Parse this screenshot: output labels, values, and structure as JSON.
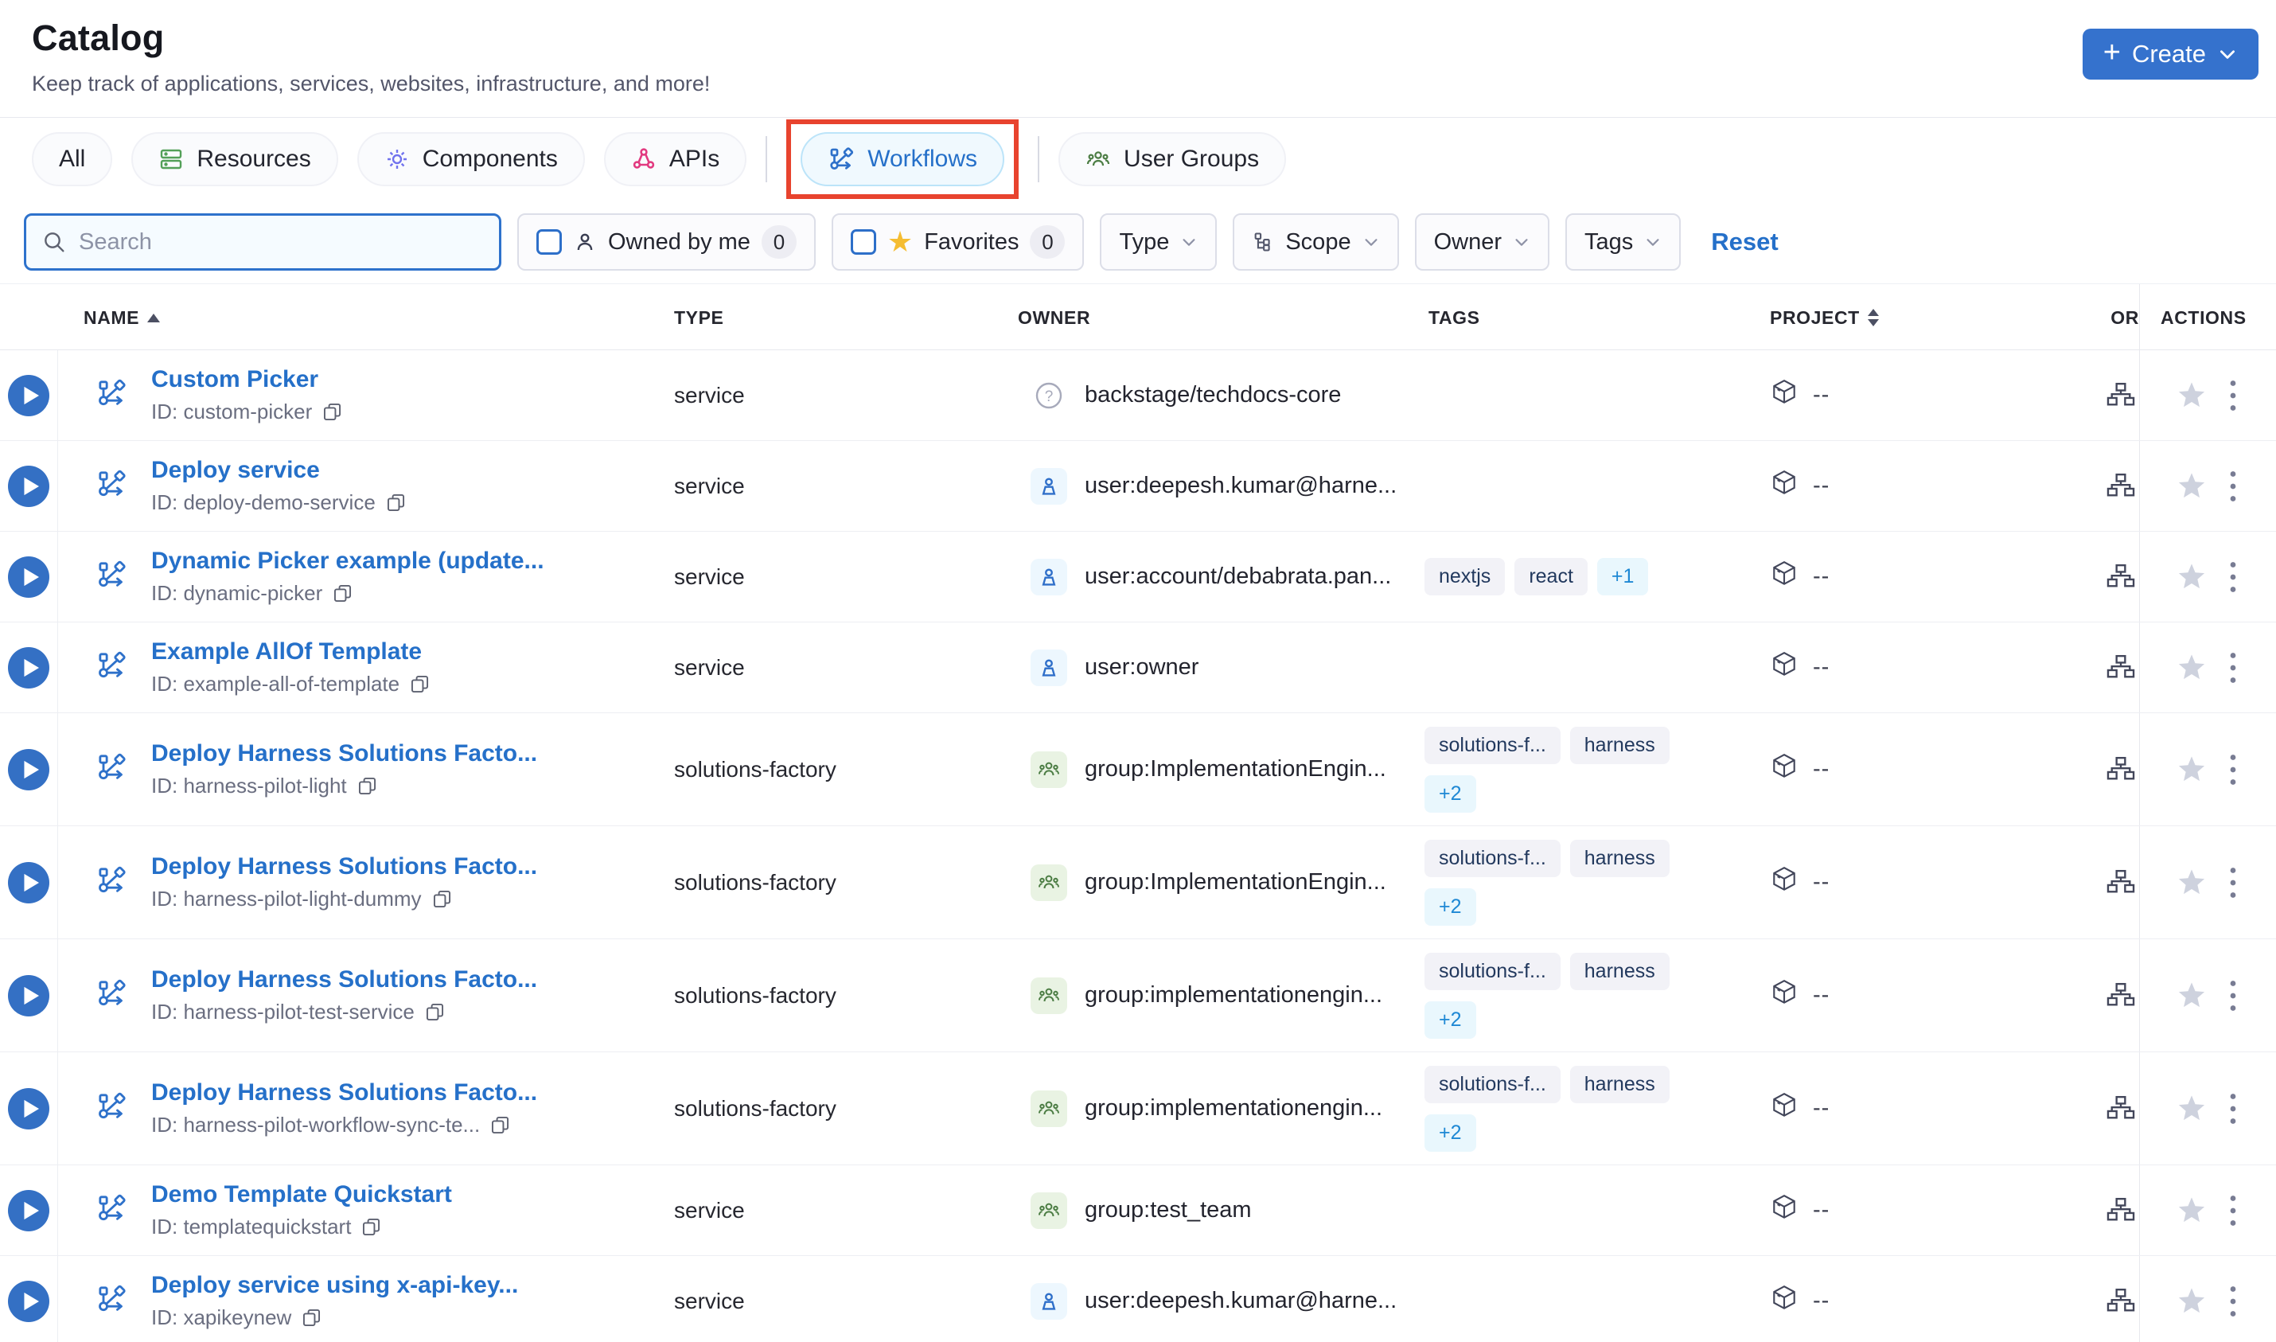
{
  "page": {
    "title": "Catalog",
    "subtitle": "Keep track of applications, services, websites, infrastructure, and more!"
  },
  "create_button": {
    "label": "Create",
    "plus": "+"
  },
  "tabs": [
    {
      "label": "All"
    },
    {
      "label": "Resources",
      "icon": "resources-icon"
    },
    {
      "label": "Components",
      "icon": "gear-icon"
    },
    {
      "label": "APIs",
      "icon": "api-nodes-icon"
    },
    {
      "label": "Workflows",
      "icon": "workflow-icon",
      "active": true,
      "annotated": true
    },
    {
      "label": "User Groups",
      "icon": "user-groups-icon"
    }
  ],
  "filters": {
    "search_placeholder": "Search",
    "owned_by_me": {
      "label": "Owned by me",
      "count": "0"
    },
    "favorites": {
      "label": "Favorites",
      "count": "0"
    },
    "type_label": "Type",
    "scope_label": "Scope",
    "owner_label": "Owner",
    "tags_label": "Tags",
    "reset_label": "Reset"
  },
  "table": {
    "columns": [
      "NAME",
      "TYPE",
      "OWNER",
      "TAGS",
      "PROJECT",
      "OR",
      "ACTIONS"
    ],
    "rows": [
      {
        "name": "Custom Picker",
        "id": "ID: custom-picker",
        "type": "service",
        "owner": {
          "kind": "unknown",
          "label": "backstage/techdocs-core"
        },
        "tag_lines": [],
        "project": "--"
      },
      {
        "name": "Deploy service",
        "id": "ID: deploy-demo-service",
        "type": "service",
        "owner": {
          "kind": "user",
          "label": "user:deepesh.kumar@harne..."
        },
        "tag_lines": [],
        "project": "--"
      },
      {
        "name": "Dynamic Picker example (update...",
        "id": "ID: dynamic-picker",
        "type": "service",
        "owner": {
          "kind": "user",
          "label": "user:account/debabrata.pan..."
        },
        "tag_lines": [
          [
            "nextjs",
            "react",
            "+1"
          ]
        ],
        "project": "--"
      },
      {
        "name": "Example AllOf Template",
        "id": "ID: example-all-of-template",
        "type": "service",
        "owner": {
          "kind": "user",
          "label": "user:owner"
        },
        "tag_lines": [],
        "project": "--"
      },
      {
        "name": "Deploy Harness Solutions Facto...",
        "id": "ID: harness-pilot-light",
        "type": "solutions-factory",
        "owner": {
          "kind": "group",
          "label": "group:ImplementationEngin..."
        },
        "tag_lines": [
          [
            "solutions-f...",
            "harness"
          ],
          [
            "+2"
          ]
        ],
        "project": "--"
      },
      {
        "name": "Deploy Harness Solutions Facto...",
        "id": "ID: harness-pilot-light-dummy",
        "type": "solutions-factory",
        "owner": {
          "kind": "group",
          "label": "group:ImplementationEngin..."
        },
        "tag_lines": [
          [
            "solutions-f...",
            "harness"
          ],
          [
            "+2"
          ]
        ],
        "project": "--"
      },
      {
        "name": "Deploy Harness Solutions Facto...",
        "id": "ID: harness-pilot-test-service",
        "type": "solutions-factory",
        "owner": {
          "kind": "group",
          "label": "group:implementationengin..."
        },
        "tag_lines": [
          [
            "solutions-f...",
            "harness"
          ],
          [
            "+2"
          ]
        ],
        "project": "--"
      },
      {
        "name": "Deploy Harness Solutions Facto...",
        "id": "ID: harness-pilot-workflow-sync-te...",
        "type": "solutions-factory",
        "owner": {
          "kind": "group",
          "label": "group:implementationengin..."
        },
        "tag_lines": [
          [
            "solutions-f...",
            "harness"
          ],
          [
            "+2"
          ]
        ],
        "project": "--"
      },
      {
        "name": "Demo Template Quickstart",
        "id": "ID: templatequickstart",
        "type": "service",
        "owner": {
          "kind": "group",
          "label": "group:test_team"
        },
        "tag_lines": [],
        "project": "--"
      },
      {
        "name": "Deploy service using x-api-key...",
        "id": "ID: xapikeynew",
        "type": "service",
        "owner": {
          "kind": "user",
          "label": "user:deepesh.kumar@harne..."
        },
        "tag_lines": [],
        "project": "--"
      }
    ]
  },
  "colors": {
    "primary_blue": "#3572cd",
    "link_blue": "#2570c9",
    "annotation_red": "#e8432e",
    "tag_bg": "#f2f2f7",
    "tag_more_bg": "#e9f7fd",
    "tag_more_text": "#1e88d4",
    "resources_green": "#53a058",
    "components_purple": "#7173ee",
    "apis_pink": "#e23a80",
    "group_green": "#4c7d44",
    "favorite_gold": "#f5bd32",
    "inactive_star": "#ced2de"
  }
}
